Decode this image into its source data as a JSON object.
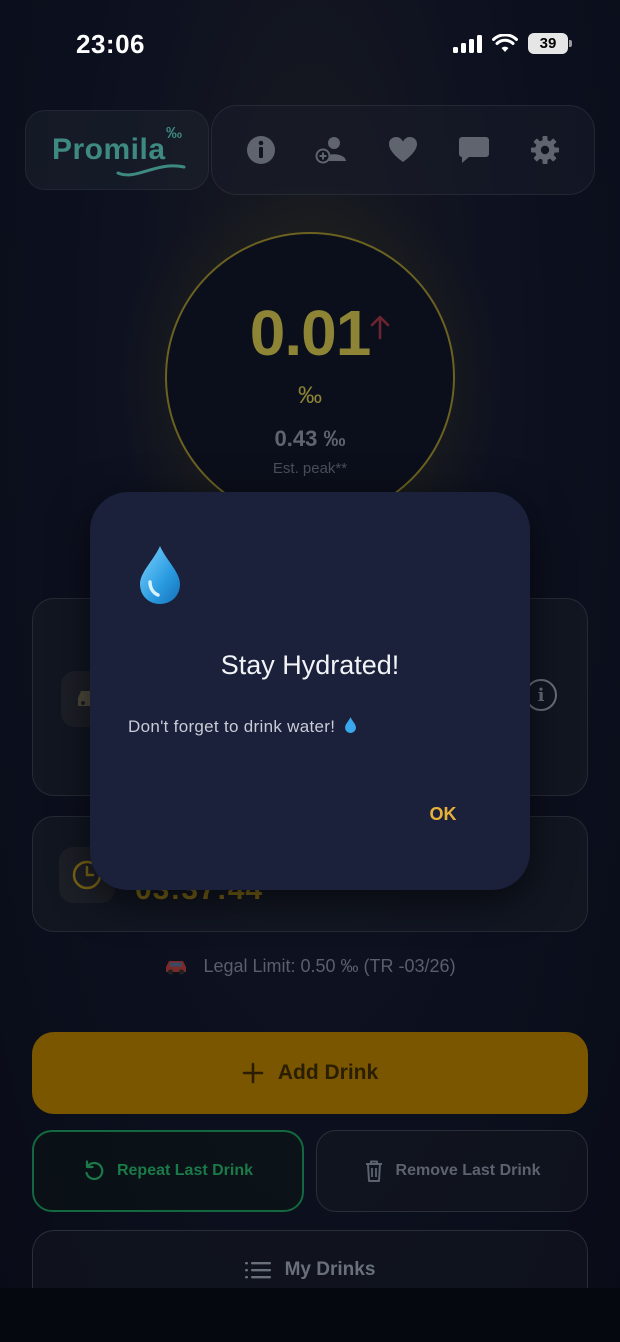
{
  "status_bar": {
    "time": "23:06",
    "battery": "39"
  },
  "header": {
    "logo_text": "Promila",
    "logo_permille": "‰",
    "nav": [
      "info-icon",
      "add-user-icon",
      "heart-icon",
      "chat-icon",
      "gear-icon"
    ]
  },
  "gauge": {
    "value": "0.01",
    "unit": "‰",
    "peak": "0.43 ‰",
    "peak_label": "Est. peak**",
    "trend": "up"
  },
  "cards": {
    "countdown": "03:37:44"
  },
  "legal_limit": "Legal Limit: 0.50 ‰ (TR -03/26)",
  "buttons": {
    "add_drink": "Add Drink",
    "repeat_last": "Repeat Last Drink",
    "remove_last": "Remove Last Drink",
    "my_drinks": "My Drinks"
  },
  "dialog": {
    "title": "Stay Hydrated!",
    "message": "Don't forget to drink water!",
    "ok": "OK"
  },
  "colors": {
    "accent": "#e8b23a",
    "gauge": "#8d8436",
    "repeat_green": "#1a7a48",
    "dialog_bg": "#1b203b"
  }
}
